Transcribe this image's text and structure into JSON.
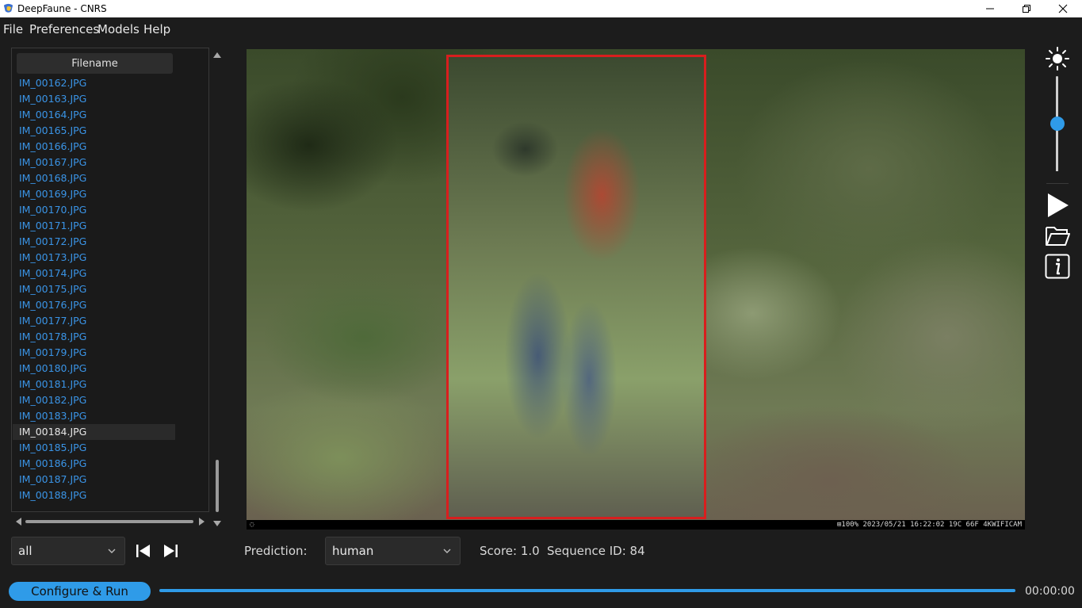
{
  "window": {
    "title": "DeepFaune - CNRS"
  },
  "menu": {
    "items": [
      "File",
      "Preferences",
      "Models",
      "Help"
    ]
  },
  "filelist": {
    "header": "Filename",
    "files": [
      "IM_00162.JPG",
      "IM_00163.JPG",
      "IM_00164.JPG",
      "IM_00165.JPG",
      "IM_00166.JPG",
      "IM_00167.JPG",
      "IM_00168.JPG",
      "IM_00169.JPG",
      "IM_00170.JPG",
      "IM_00171.JPG",
      "IM_00172.JPG",
      "IM_00173.JPG",
      "IM_00174.JPG",
      "IM_00175.JPG",
      "IM_00176.JPG",
      "IM_00177.JPG",
      "IM_00178.JPG",
      "IM_00179.JPG",
      "IM_00180.JPG",
      "IM_00181.JPG",
      "IM_00182.JPG",
      "IM_00183.JPG",
      "IM_00184.JPG",
      "IM_00185.JPG",
      "IM_00186.JPG",
      "IM_00187.JPG",
      "IM_00188.JPG"
    ],
    "selected": "IM_00184.JPG"
  },
  "viewer": {
    "overlay_left": "◌",
    "overlay_right": "⊞100%   2023/05/21 16:22:02  19C 66F 4KWIFICAM"
  },
  "brightness": {
    "level_fraction": 0.5
  },
  "filter": {
    "value": "all"
  },
  "prediction": {
    "label": "Prediction:",
    "value": "human"
  },
  "score": {
    "text": "Score: 1.0"
  },
  "sequence": {
    "text": "Sequence ID: 84"
  },
  "run": {
    "label": "Configure & Run",
    "time": "00:00:00"
  },
  "colors": {
    "accent": "#2f9be8",
    "bbox": "#d81e1e",
    "link": "#3a94e6",
    "background": "#1c1c1c"
  }
}
